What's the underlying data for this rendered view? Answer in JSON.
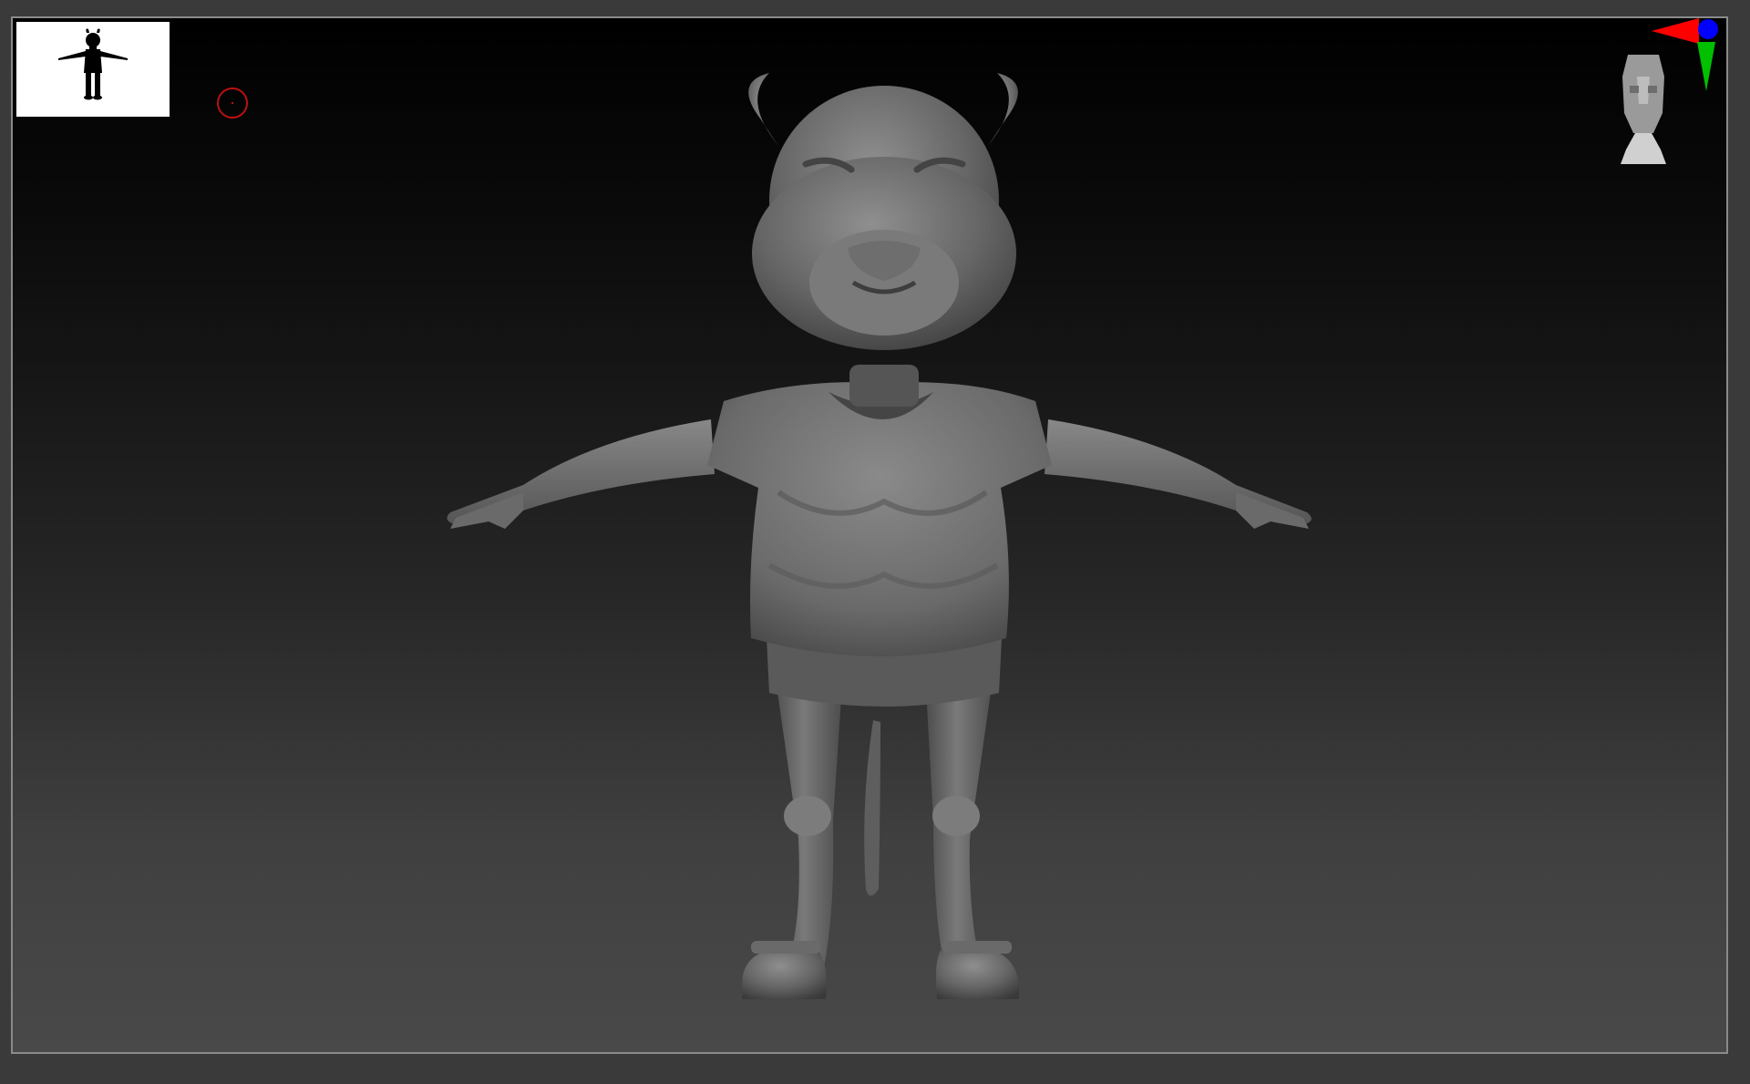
{
  "app": {
    "title": "",
    "viewport_background": [
      "#000000",
      "#494949"
    ]
  },
  "thumbnail": {
    "icon": "character-silhouette-icon",
    "background": "#ffffff"
  },
  "brush_cursor": {
    "color": "#bb1111"
  },
  "model": {
    "description_icon": "sculpt-mesh-icon"
  },
  "gyro": {
    "x_color": "#ff0000",
    "y_color": "#00c000",
    "z_color": "#0000ff"
  },
  "nav_head": {
    "icon": "navigation-head-icon"
  }
}
